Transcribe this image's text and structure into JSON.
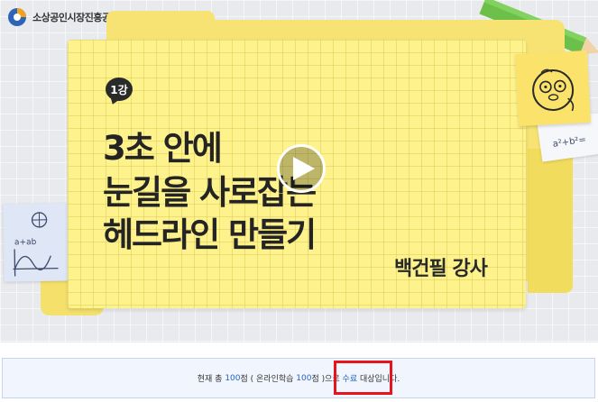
{
  "brand": {
    "logo_text": "소상공인시장진흥공단",
    "logo_icon": "semas-logo-icon"
  },
  "video": {
    "lesson_badge": "1강",
    "title_lines": [
      "3초 안에",
      "눈길을 사로잡는",
      "헤드라인 만들기"
    ],
    "instructor": "백건필 강사",
    "play_icon": "play-icon",
    "sticky_math_left": "a+ab",
    "sticky_math_right": "a²+b²="
  },
  "notice": {
    "prefix": "현재 총 ",
    "total_score": "100",
    "mid1": "점 ( 온라인학습 ",
    "online_score": "100",
    "mid2": "점 )으로 ",
    "status": "수료",
    "suffix": " 대상입니다."
  },
  "colors": {
    "card": "#fdf28b",
    "folder": "#f6e374",
    "accent_blue": "#1f63c6",
    "highlight_red": "#e8141b"
  }
}
